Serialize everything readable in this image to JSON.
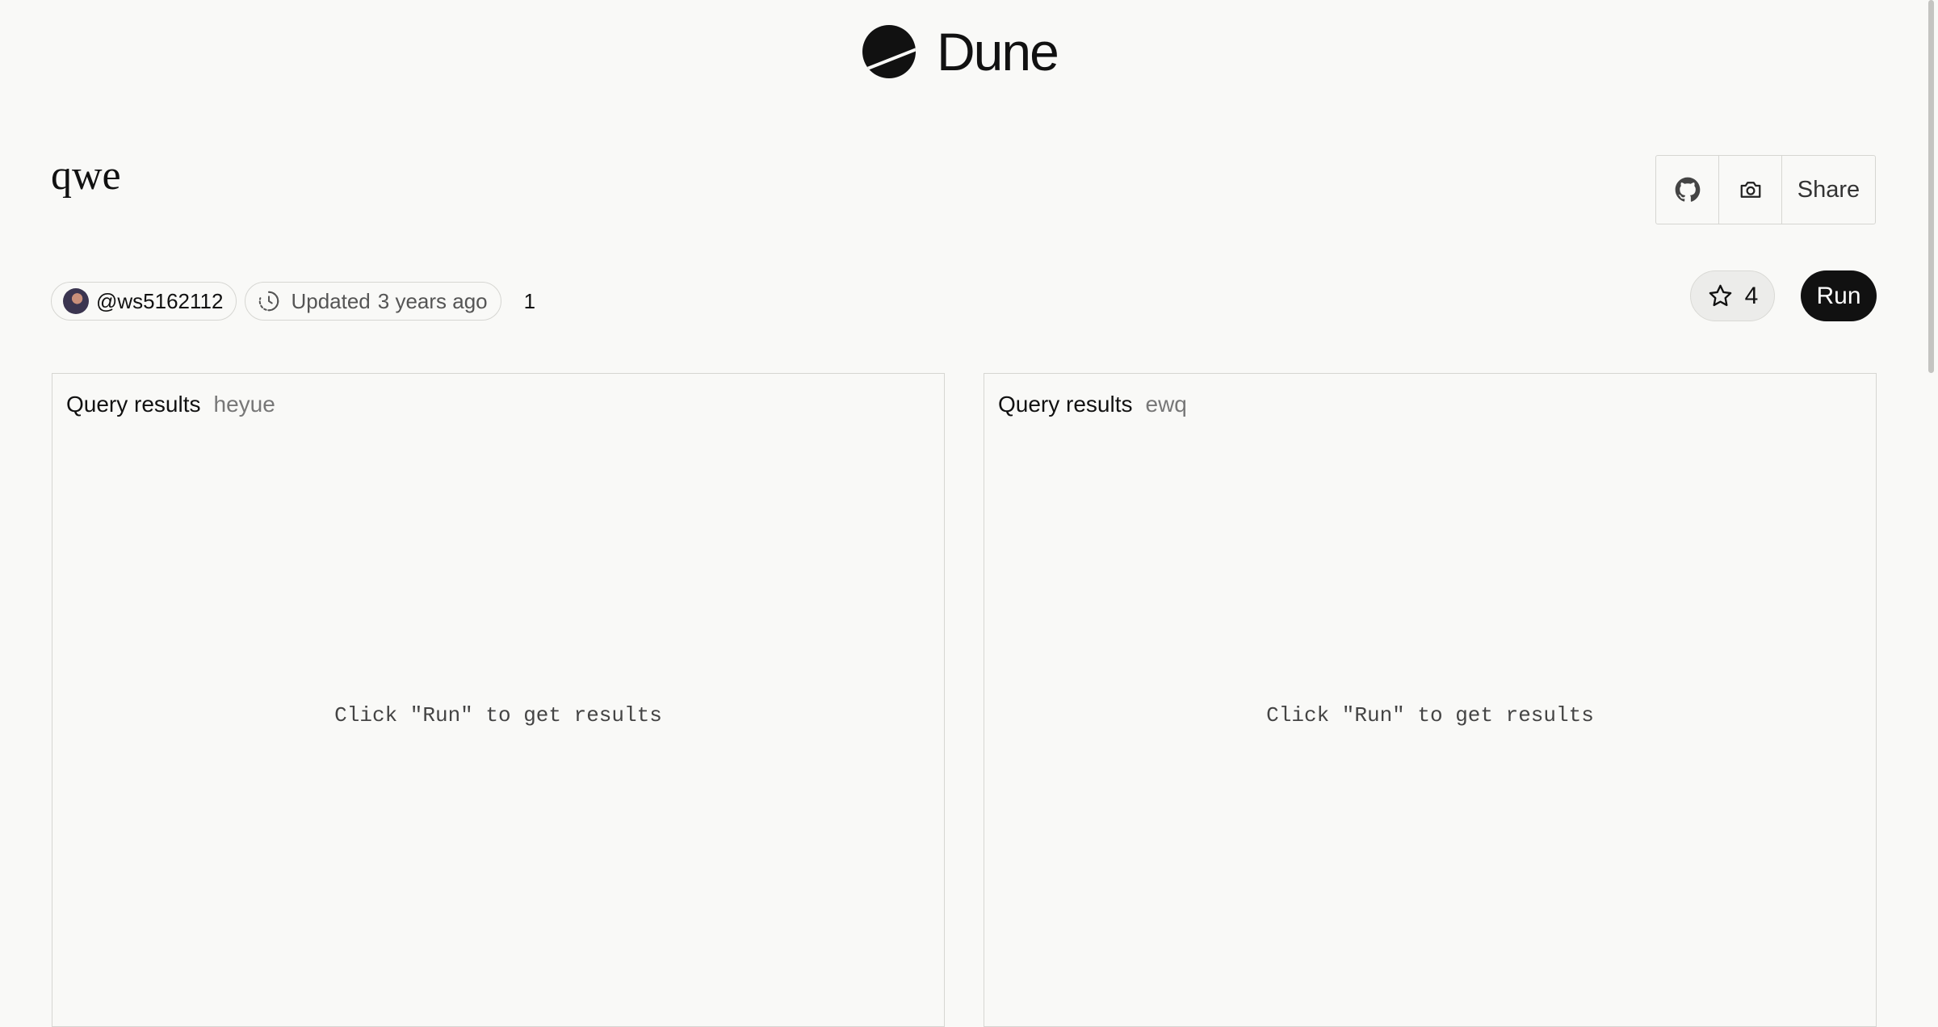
{
  "header": {
    "logo_text": "Dune",
    "logo_icon": "dune-logo-icon"
  },
  "query": {
    "title": "qwe"
  },
  "actions": {
    "github_icon": "github-icon",
    "camera_icon": "camera-icon",
    "share_label": "Share"
  },
  "meta": {
    "user_handle": "@ws5162112",
    "updated_label": "Updated",
    "updated_value": "3 years ago",
    "count": "1"
  },
  "star": {
    "icon": "star-icon",
    "count": "4"
  },
  "run": {
    "label": "Run"
  },
  "panels": [
    {
      "title": "Query results",
      "subtitle": "heyue",
      "empty_message": "Click \"Run\" to get results"
    },
    {
      "title": "Query results",
      "subtitle": "ewq",
      "empty_message": "Click \"Run\" to get results"
    }
  ],
  "colors": {
    "background": "#f9f9f7",
    "run_button": "#111111",
    "border": "#d6d6d2"
  }
}
